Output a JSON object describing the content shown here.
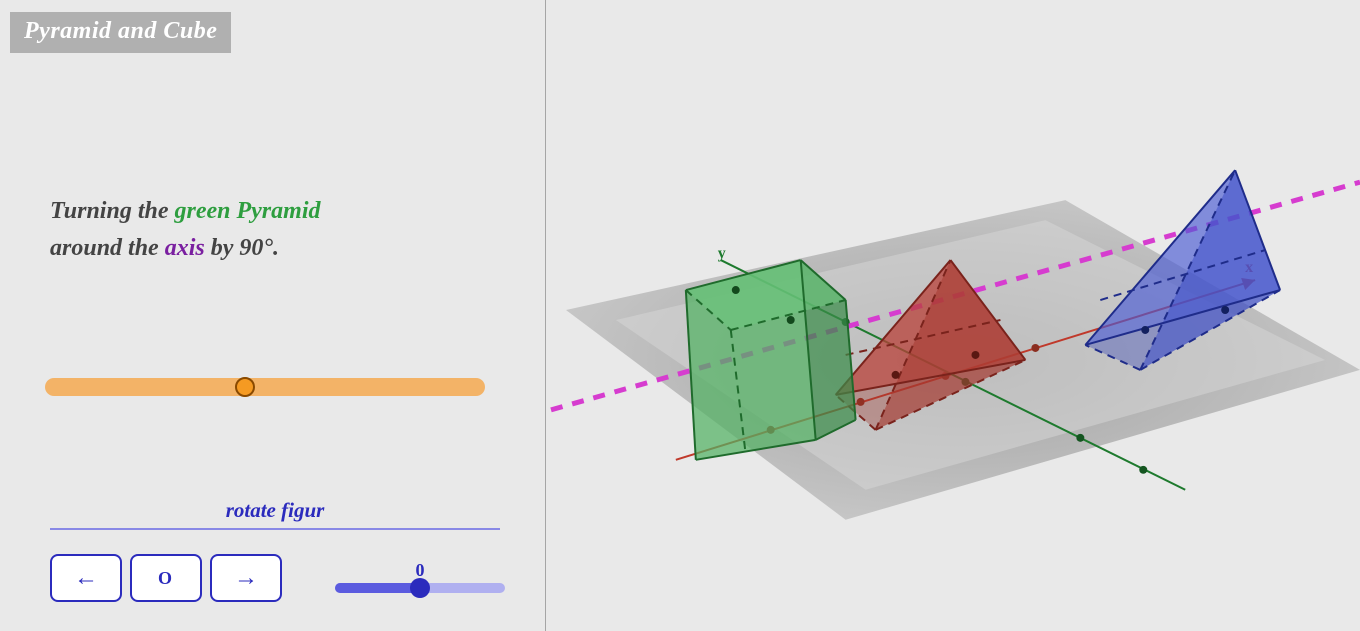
{
  "title": "Pyramid and Cube",
  "instruction": {
    "part1": "Turning the ",
    "green_text": "green Pyramid",
    "part2": "around the ",
    "axis_text": "axis",
    "part3": " by 90°."
  },
  "orange_slider": {
    "value": 0
  },
  "rotate": {
    "heading": "rotate figur",
    "value": "0",
    "buttons": {
      "left": "←",
      "reset": "O",
      "right": "→"
    }
  },
  "axes": {
    "x_label": "x",
    "y_label": "y"
  },
  "colors": {
    "green": "#2e9e3f",
    "red": "#c0392b",
    "blue": "#2b3fbf",
    "magenta": "#d63ccf",
    "orange": "#f3b367",
    "orange_thumb": "#f59a22",
    "indigo": "#2b2bbd"
  }
}
